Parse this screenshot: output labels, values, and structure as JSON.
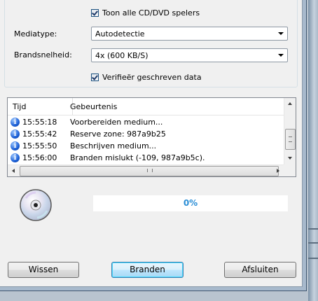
{
  "options": {
    "show_all_drives_label": "Toon alle CD/DVD spelers",
    "show_all_drives_checked": true,
    "media_type_label": "Mediatype:",
    "media_type_value": "Autodetectie",
    "burn_speed_label": "Brandsnelheid:",
    "burn_speed_value": "4x (600 KB/S)",
    "verify_label": "Verifieër geschreven data",
    "verify_checked": true
  },
  "log": {
    "columns": [
      "Tijd",
      "Gebeurtenis"
    ],
    "rows": [
      {
        "icon": "info-icon",
        "time": "15:55:18",
        "event": "Voorbereiden medium..."
      },
      {
        "icon": "info-icon",
        "time": "15:55:42",
        "event": "Reserve zone: 987a9b25"
      },
      {
        "icon": "info-icon",
        "time": "15:55:50",
        "event": "Beschrijven medium..."
      },
      {
        "icon": "info-icon",
        "time": "15:56:00",
        "event": "Branden mislukt (-109, 987a9b5c)."
      }
    ]
  },
  "progress": {
    "percent_label": "0%",
    "value": 0
  },
  "buttons": {
    "clear": "Wissen",
    "burn": "Branden",
    "close": "Afsluiten"
  },
  "colors": {
    "progress_text": "#2b8ed6",
    "default_button_border": "#3c7fb1"
  }
}
